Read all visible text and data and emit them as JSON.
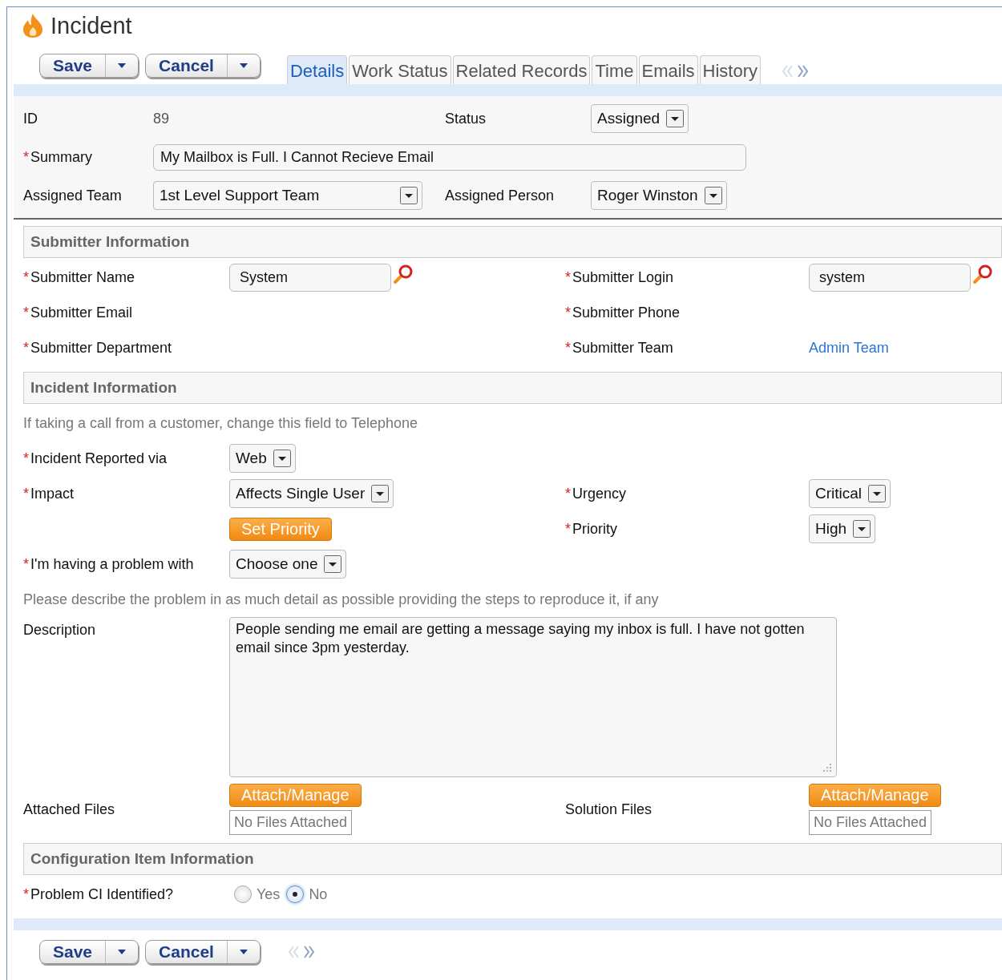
{
  "page": {
    "title": "Incident"
  },
  "toolbar": {
    "buttons": [
      {
        "label": "Save"
      },
      {
        "label": "Cancel"
      }
    ]
  },
  "tabs": [
    {
      "label": "Details",
      "selected": true
    },
    {
      "label": "Work Status",
      "selected": false
    },
    {
      "label": "Related Records",
      "selected": false
    },
    {
      "label": "Time",
      "selected": false
    },
    {
      "label": "Emails",
      "selected": false
    },
    {
      "label": "History",
      "selected": false
    }
  ],
  "pager": [
    {
      "kind": "prev",
      "disabled": true
    },
    {
      "kind": "next",
      "disabled": false
    }
  ],
  "header": {
    "rows": [
      {
        "cells": [
          {
            "kind": "label",
            "text": "ID"
          },
          {
            "kind": "text",
            "value": "89"
          },
          {
            "kind": "label",
            "text": "Status"
          },
          {
            "kind": "select",
            "value": "Assigned"
          }
        ]
      },
      {
        "cells": [
          {
            "kind": "label",
            "required_mark": "*",
            "text": "Summary"
          },
          {
            "kind": "input",
            "value": "My Mailbox is Full. I Cannot Recieve Email"
          }
        ]
      },
      {
        "cells": [
          {
            "kind": "label",
            "text": "Assigned Team"
          },
          {
            "kind": "select",
            "value": "1st Level Support Team"
          },
          {
            "kind": "label",
            "text": "Assigned Person"
          },
          {
            "kind": "select",
            "value": "Roger Winston"
          }
        ]
      }
    ]
  },
  "sections": [
    {
      "title": "Submitter Information",
      "rows": [
        {
          "cells": [
            {
              "kind": "label",
              "required_mark": "*",
              "text": "Submitter Name"
            },
            {
              "kind": "lookup",
              "value": "System"
            },
            {
              "kind": "label",
              "required_mark": "*",
              "text": "Submitter Login"
            },
            {
              "kind": "lookup",
              "value": "system"
            }
          ]
        },
        {
          "cells": [
            {
              "kind": "label",
              "required_mark": "*",
              "text": "Submitter Email"
            },
            null,
            {
              "kind": "label",
              "required_mark": "*",
              "text": "Submitter Phone"
            },
            null
          ]
        },
        {
          "cells": [
            {
              "kind": "label",
              "required_mark": "*",
              "text": "Submitter Department"
            },
            null,
            {
              "kind": "label",
              "required_mark": "*",
              "text": "Submitter Team"
            },
            {
              "kind": "link",
              "text": "Admin Team"
            }
          ]
        }
      ]
    },
    {
      "title": "Incident Information",
      "rows": [
        {
          "cells": [
            {
              "kind": "note",
              "text": "If taking a call from a customer, change this field to Telephone"
            }
          ]
        },
        {
          "cells": [
            {
              "kind": "label",
              "required_mark": "*",
              "text": "Incident Reported via"
            },
            {
              "kind": "select",
              "value": "Web"
            },
            null,
            null
          ]
        },
        {
          "cells": [
            {
              "kind": "label",
              "required_mark": "*",
              "text": "Impact"
            },
            {
              "kind": "select",
              "value": "Affects Single User"
            },
            {
              "kind": "label",
              "required_mark": "*",
              "text": "Urgency"
            },
            {
              "kind": "select",
              "value": "Critical"
            }
          ]
        },
        {
          "cells": [
            null,
            {
              "kind": "button",
              "text": "Set Priority"
            },
            {
              "kind": "label",
              "required_mark": "*",
              "text": "Priority"
            },
            {
              "kind": "select",
              "value": "High"
            }
          ]
        },
        {
          "cells": [
            {
              "kind": "label",
              "required_mark": "*",
              "text": "I'm having a problem with"
            },
            {
              "kind": "select",
              "value": "Choose one"
            },
            null,
            null
          ]
        },
        {
          "cells": [
            {
              "kind": "note",
              "text": "Please describe the problem in as much detail as possible providing the steps to reproduce it, if any"
            }
          ]
        },
        {
          "cells": [
            {
              "kind": "label",
              "text": "Description"
            },
            {
              "kind": "textarea",
              "value": "People sending me email are getting a message saying my inbox is full. I have not gotten email since 3pm yesterday."
            }
          ]
        },
        {
          "cells": [
            {
              "kind": "label",
              "text": "Attached Files"
            },
            {
              "kind": "files",
              "button": "Attach/Manage",
              "status": "No Files Attached"
            },
            {
              "kind": "label",
              "text": "Solution Files"
            },
            {
              "kind": "files",
              "button": "Attach/Manage",
              "status": "No Files Attached"
            }
          ]
        }
      ]
    },
    {
      "title": "Configuration Item Information",
      "rows": [
        {
          "cells": [
            {
              "kind": "label",
              "required_mark": "*",
              "text": "Problem CI Identified?"
            },
            {
              "kind": "radio",
              "options": [
                {
                  "label": "Yes",
                  "selected": false
                },
                {
                  "label": "No",
                  "selected": true
                }
              ]
            }
          ]
        }
      ]
    }
  ],
  "footer": {
    "buttons": [
      {
        "label": "Save"
      },
      {
        "label": "Cancel"
      }
    ],
    "pager": [
      {
        "kind": "prev",
        "disabled": true
      },
      {
        "kind": "next",
        "disabled": false
      }
    ]
  }
}
